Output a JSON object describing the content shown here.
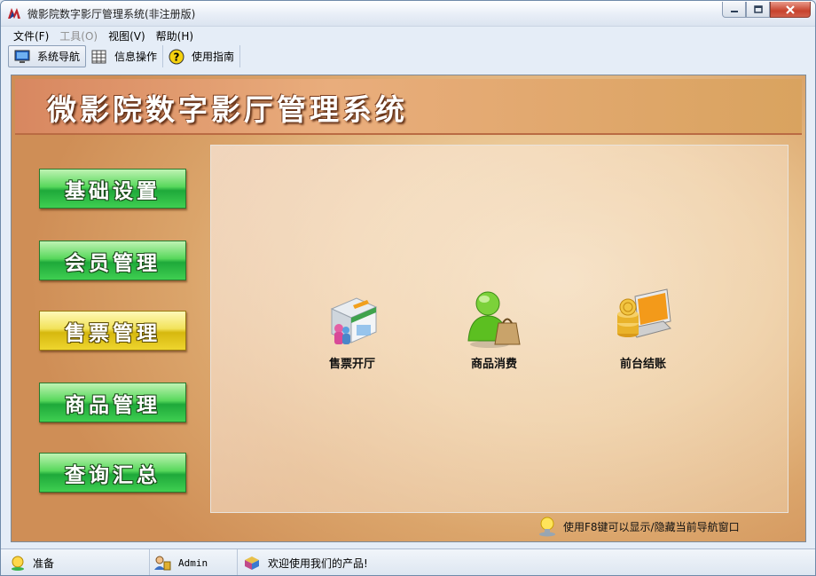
{
  "window": {
    "title": "微影院数字影厅管理系统(非注册版)"
  },
  "menubar": [
    {
      "label": "文件(F)",
      "enabled": true
    },
    {
      "label": "工具(O)",
      "enabled": false
    },
    {
      "label": "视图(V)",
      "enabled": true
    },
    {
      "label": "帮助(H)",
      "enabled": true
    }
  ],
  "toolbar": [
    {
      "label": "系统导航",
      "icon": "monitor-icon",
      "active": true
    },
    {
      "label": "信息操作",
      "icon": "grid-icon",
      "active": false
    },
    {
      "label": "使用指南",
      "icon": "help-icon",
      "active": false
    }
  ],
  "header": {
    "title": "微影院数字影厅管理系统"
  },
  "nav": [
    {
      "label": "基础设置",
      "selected": false
    },
    {
      "label": "会员管理",
      "selected": false
    },
    {
      "label": "售票管理",
      "selected": true
    },
    {
      "label": "商品管理",
      "selected": false
    },
    {
      "label": "查询汇总",
      "selected": false
    }
  ],
  "functions": [
    {
      "label": "售票开厅",
      "icon": "ticket-booth-icon"
    },
    {
      "label": "商品消费",
      "icon": "shopping-user-icon"
    },
    {
      "label": "前台结账",
      "icon": "cashier-laptop-icon"
    }
  ],
  "hint": {
    "text": "使用F8键可以显示/隐藏当前导航窗口"
  },
  "status": [
    {
      "text": "准备",
      "icon": "ready-icon"
    },
    {
      "text": "Admin",
      "icon": "user-icon"
    },
    {
      "text": "欢迎使用我们的产品!",
      "icon": "product-box-icon"
    }
  ],
  "colors": {
    "nav_green": "#3fcf51",
    "nav_selected_yellow": "#eed52e",
    "content_bg": "#ebc896"
  }
}
